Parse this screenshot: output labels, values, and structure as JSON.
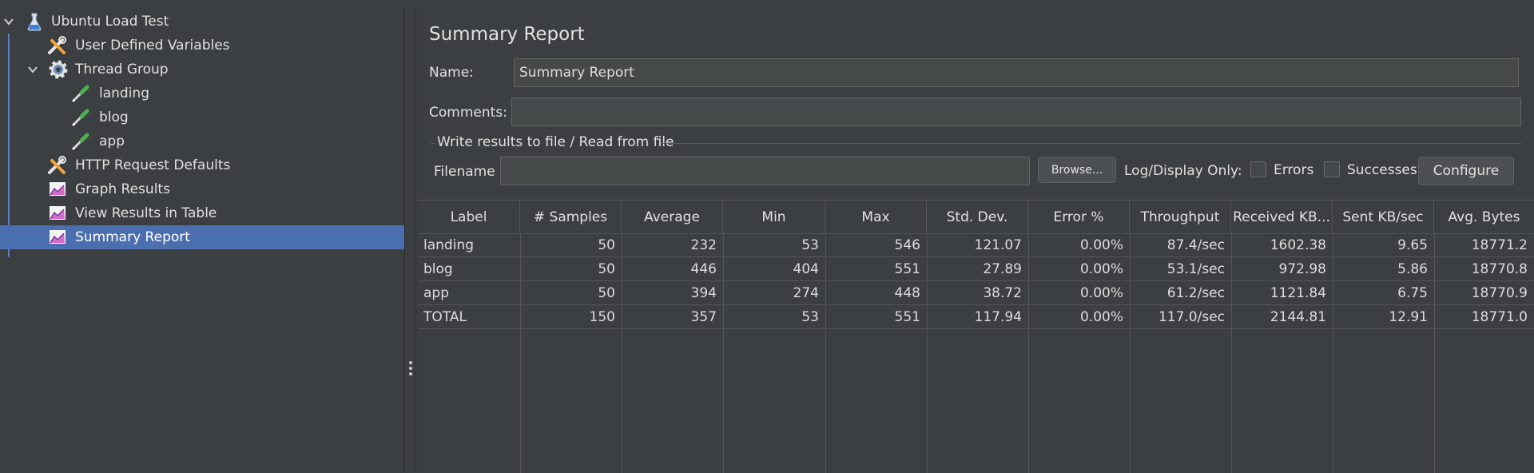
{
  "tree": {
    "items": [
      {
        "label": "Ubuntu Load Test",
        "icon": "flask-icon",
        "expanded": true
      },
      {
        "label": "User Defined Variables",
        "icon": "wrench-screwdriver-icon"
      },
      {
        "label": "Thread Group",
        "icon": "gear-icon",
        "expanded": true
      },
      {
        "label": "landing",
        "icon": "pipette-icon"
      },
      {
        "label": "blog",
        "icon": "pipette-icon"
      },
      {
        "label": "app",
        "icon": "pipette-icon"
      },
      {
        "label": "HTTP Request Defaults",
        "icon": "wrench-screwdriver-icon"
      },
      {
        "label": "Graph Results",
        "icon": "chart-icon"
      },
      {
        "label": "View Results in Table",
        "icon": "chart-icon"
      },
      {
        "label": "Summary Report",
        "icon": "chart-icon",
        "selected": true
      }
    ]
  },
  "panel": {
    "title": "Summary Report",
    "name_label": "Name:",
    "name_value": "Summary Report",
    "comments_label": "Comments:",
    "comments_value": "",
    "file_group_title": "Write results to file / Read from file",
    "filename_label": "Filename",
    "filename_value": "",
    "browse_label": "Browse...",
    "log_display_label": "Log/Display Only:",
    "errors_label": "Errors",
    "errors_checked": false,
    "successes_label": "Successes",
    "successes_checked": false,
    "configure_label": "Configure"
  },
  "table": {
    "columns": [
      "Label",
      "# Samples",
      "Average",
      "Min",
      "Max",
      "Std. Dev.",
      "Error %",
      "Throughput",
      "Received KB...",
      "Sent KB/sec",
      "Avg. Bytes"
    ],
    "rows": [
      [
        "landing",
        "50",
        "232",
        "53",
        "546",
        "121.07",
        "0.00%",
        "87.4/sec",
        "1602.38",
        "9.65",
        "18771.2"
      ],
      [
        "blog",
        "50",
        "446",
        "404",
        "551",
        "27.89",
        "0.00%",
        "53.1/sec",
        "972.98",
        "5.86",
        "18770.8"
      ],
      [
        "app",
        "50",
        "394",
        "274",
        "448",
        "38.72",
        "0.00%",
        "61.2/sec",
        "1121.84",
        "6.75",
        "18770.9"
      ],
      [
        "TOTAL",
        "150",
        "357",
        "53",
        "551",
        "117.94",
        "0.00%",
        "117.0/sec",
        "2144.81",
        "12.91",
        "18771.0"
      ]
    ]
  },
  "colors": {
    "background": "#3c3f41",
    "selection": "#4b6eaf",
    "text": "#e0e0e0"
  }
}
